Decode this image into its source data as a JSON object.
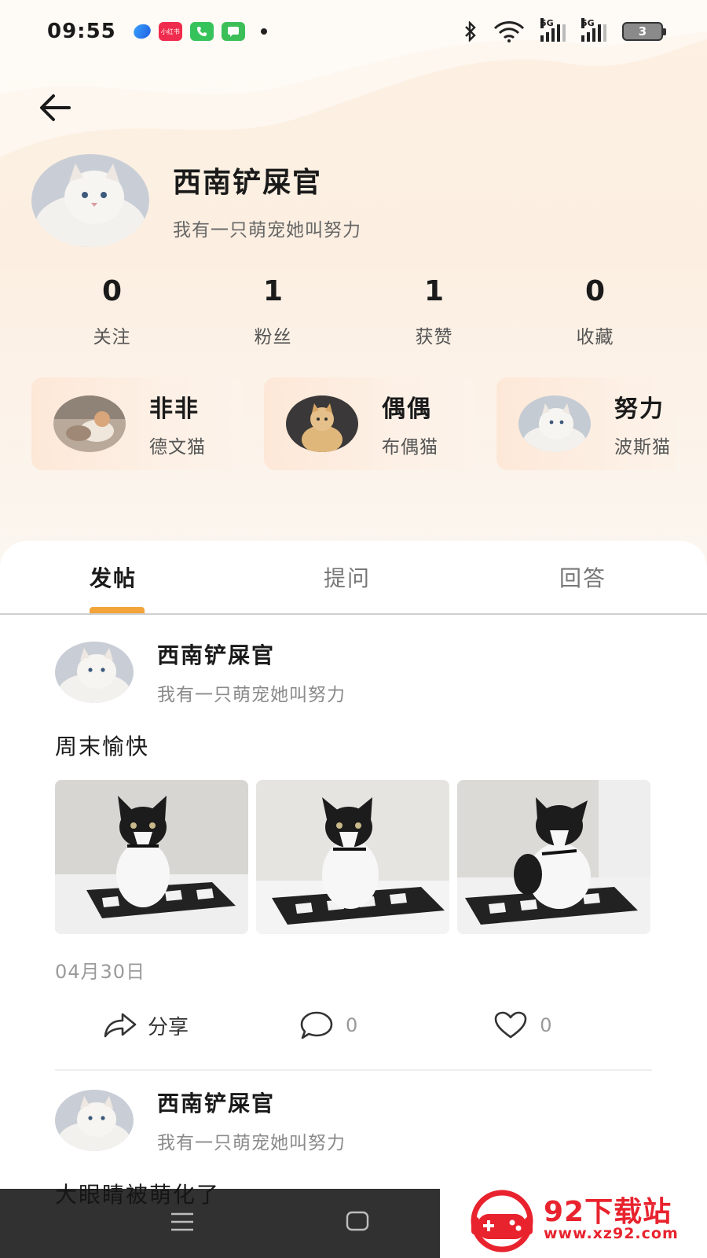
{
  "status_bar": {
    "time": "09:55",
    "app_label": "小红书",
    "network_1": "5G",
    "network_2": "5G",
    "battery": "3"
  },
  "profile": {
    "name": "西南铲屎官",
    "bio": "我有一只萌宠她叫努力"
  },
  "stats": [
    {
      "value": "0",
      "label": "关注"
    },
    {
      "value": "1",
      "label": "粉丝"
    },
    {
      "value": "1",
      "label": "获赞"
    },
    {
      "value": "0",
      "label": "收藏"
    }
  ],
  "pets": [
    {
      "name": "非非",
      "breed": "德文猫"
    },
    {
      "name": "偶偶",
      "breed": "布偶猫"
    },
    {
      "name": "努力",
      "breed": "波斯猫"
    }
  ],
  "tabs": [
    {
      "label": "发帖",
      "active": true
    },
    {
      "label": "提问",
      "active": false
    },
    {
      "label": "回答",
      "active": false
    }
  ],
  "posts": [
    {
      "author": "西南铲屎官",
      "bio": "我有一只萌宠她叫努力",
      "text": "周末愉快",
      "date": "04月30日",
      "share_label": "分享",
      "comments": "0",
      "likes": "0"
    },
    {
      "author": "西南铲屎官",
      "bio": "我有一只萌宠她叫努力",
      "text": "大眼睛被萌化了"
    }
  ],
  "watermark": {
    "title": "92下载站",
    "url": "www.xz92.com"
  },
  "colors": {
    "accent": "#f2a33a",
    "watermark_red": "#e8232e"
  }
}
